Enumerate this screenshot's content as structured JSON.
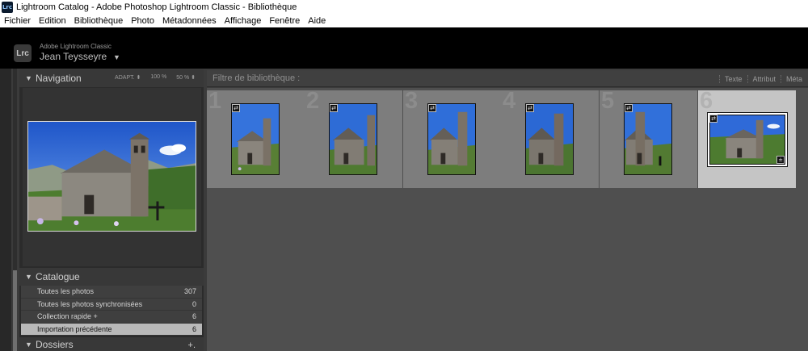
{
  "window": {
    "app_icon": "Lrc",
    "title": "Lightroom Catalog - Adobe Photoshop Lightroom Classic - Bibliothèque"
  },
  "menu": [
    "Fichier",
    "Edition",
    "Bibliothèque",
    "Photo",
    "Métadonnées",
    "Affichage",
    "Fenêtre",
    "Aide"
  ],
  "identity": {
    "badge": "Lrc",
    "product": "Adobe Lightroom Classic",
    "user": "Jean Teysseyre",
    "caret": "▼"
  },
  "navigator": {
    "title": "Navigation",
    "options": [
      "ADAPT. ⬍",
      "100 %",
      "50 % ⬍"
    ]
  },
  "catalog": {
    "title": "Catalogue",
    "items": [
      {
        "label": "Toutes les photos",
        "count": "307"
      },
      {
        "label": "Toutes les photos synchronisées",
        "count": "0"
      },
      {
        "label": "Collection rapide +",
        "count": "6"
      },
      {
        "label": "Importation précédente",
        "count": "6",
        "selected": true
      }
    ]
  },
  "folders": {
    "title": "Dossiers",
    "add": "+."
  },
  "filter": {
    "title": "Filtre de bibliothèque :",
    "tabs": [
      "Texte",
      "Attribut",
      "Méta"
    ]
  },
  "grid": {
    "cells": [
      {
        "index": "1",
        "badge": "⇄"
      },
      {
        "index": "2",
        "badge": "⇄"
      },
      {
        "index": "3",
        "badge": "⇄"
      },
      {
        "index": "4",
        "badge": "⇄"
      },
      {
        "index": "5",
        "badge": "⇄"
      },
      {
        "index": "6",
        "badge": "⇄",
        "selected": true
      }
    ]
  },
  "colors": {
    "sky": "#2f6bd8",
    "selected_cell": "#c5c5c5",
    "cell": "#7d7d7d"
  }
}
